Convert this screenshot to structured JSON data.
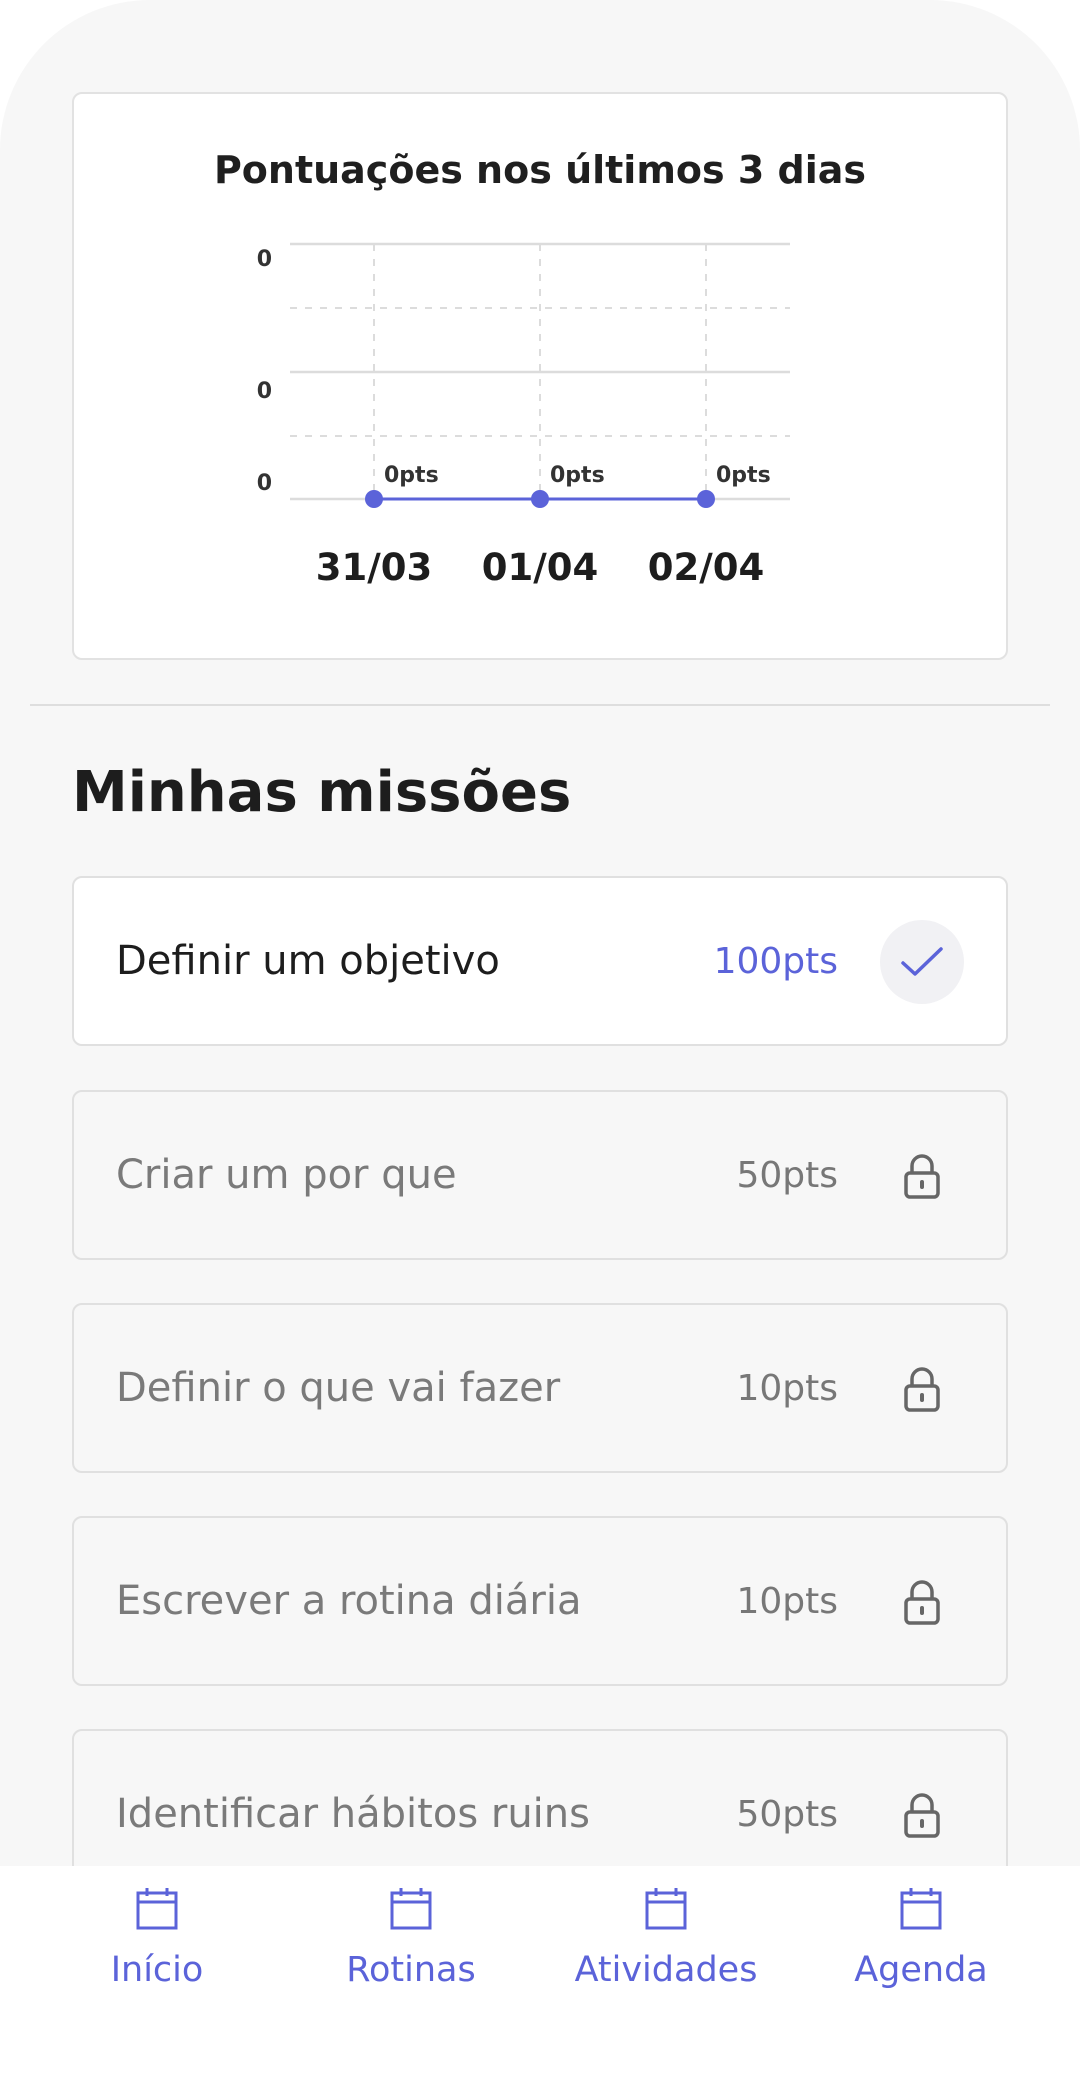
{
  "chart_data": {
    "type": "line",
    "title": "Pontuações nos últimos 3 dias",
    "categories": [
      "31/03",
      "01/04",
      "02/04"
    ],
    "values": [
      0,
      0,
      0
    ],
    "data_labels": [
      "0pts",
      "0pts",
      "0pts"
    ],
    "y_tick_labels": [
      "0",
      "0",
      "0"
    ],
    "ylim": [
      0,
      0
    ],
    "grid": true,
    "color": "#5b63d9"
  },
  "missions": {
    "title": "Minhas missões",
    "items": [
      {
        "label": "Definir um objetivo",
        "points": "100pts",
        "status": "check-icon"
      },
      {
        "label": "Criar um por que",
        "points": "50pts",
        "status": "lock-icon"
      },
      {
        "label": "Definir o que vai fazer",
        "points": "10pts",
        "status": "lock-icon"
      },
      {
        "label": "Escrever a rotina diária",
        "points": "10pts",
        "status": "lock-icon"
      },
      {
        "label": "Identificar hábitos ruins",
        "points": "50pts",
        "status": "lock-icon"
      }
    ]
  },
  "nav": {
    "items": [
      {
        "label": "Início",
        "icon": "calendar-icon"
      },
      {
        "label": "Rotinas",
        "icon": "calendar-icon"
      },
      {
        "label": "Atividades",
        "icon": "calendar-icon"
      },
      {
        "label": "Agenda",
        "icon": "calendar-icon"
      }
    ]
  },
  "colors": {
    "accent": "#5b63d9",
    "muted_text": "#7a7a7a",
    "background": "#f7f7f7"
  }
}
